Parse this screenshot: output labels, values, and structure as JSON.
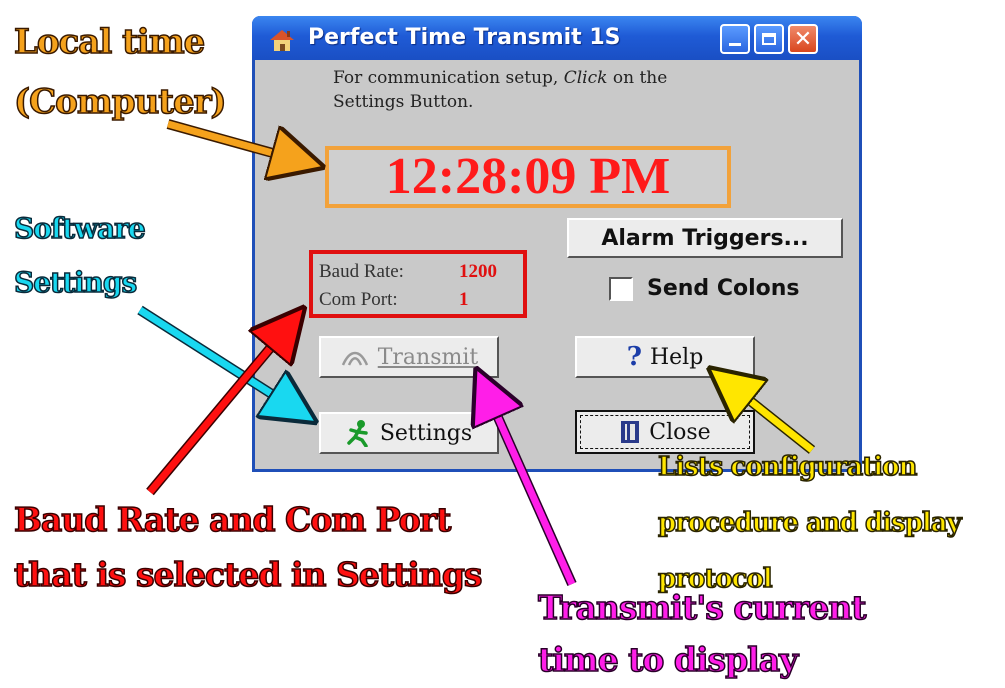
{
  "window": {
    "title": "Perfect Time Transmit 1S",
    "note_line1_prefix": "For communication setup, ",
    "note_line1_emph": "Click",
    "note_line1_suffix": " on the",
    "note_line2": "Settings Button.",
    "clock_time": "12:28:09 PM",
    "alarm_button": "Alarm Triggers...",
    "baud_label": "Baud Rate:",
    "baud_value": "1200",
    "com_label": "Com Port:",
    "com_value": "1",
    "send_colons_label": "Send Colons",
    "send_colons_checked": false,
    "transmit_button": "Transmit",
    "help_button": "Help",
    "settings_button": "Settings",
    "close_button": "Close"
  },
  "annotations": {
    "local_time_1": "Local time",
    "local_time_2": "(Computer)",
    "software_1": "Software",
    "software_2": "Settings",
    "baud_com_1": "Baud Rate and Com Port",
    "baud_com_2": "that is selected in Settings",
    "help_1": "Lists configuration",
    "help_2": "procedure and display",
    "help_3": "protocol",
    "transmit_1": "Transmit's current",
    "transmit_2": "time to display"
  },
  "colors": {
    "orange": "#f5a21c",
    "cyan": "#19d8f0",
    "red": "#ff1010",
    "yellow": "#ffe600",
    "magenta": "#ff1ee8",
    "titlebar": "#1f5bd6"
  },
  "icons": {
    "app": "house-icon",
    "minimize": "minimize-icon",
    "maximize": "maximize-icon",
    "close": "close-icon",
    "transmit": "signal-icon",
    "help": "question-icon",
    "settings": "runner-icon",
    "close_button": "door-icon"
  }
}
